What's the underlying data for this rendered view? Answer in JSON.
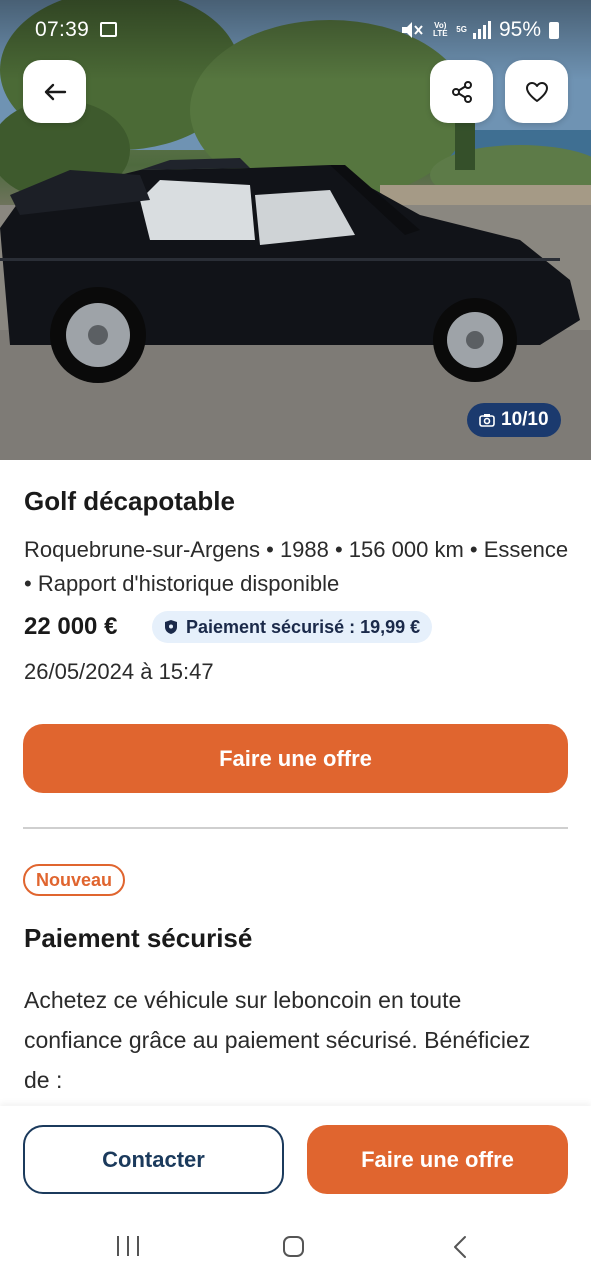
{
  "status_bar": {
    "time": "07:39",
    "battery": "95%",
    "icons": [
      "image-icon",
      "mute-icon",
      "volte-icon",
      "5g-icon",
      "signal-icon",
      "battery-icon"
    ],
    "volte_label": "Vo) LTE",
    "network_label": "5G"
  },
  "photo": {
    "counter": "10/10",
    "counter_icon": "camera-icon"
  },
  "header_buttons": {
    "back_icon": "arrow-left-icon",
    "share_icon": "share-icon",
    "favorite_icon": "heart-icon"
  },
  "listing": {
    "title": "Golf décapotable",
    "details": "Roquebrune-sur-Argens • 1988 • 156 000 km • Essence • Rapport d'historique disponible",
    "price": "22 000 €",
    "secure_payment_badge": "Paiement sécurisé : 19,99 €",
    "date": "26/05/2024 à 15:47",
    "offer_button": "Faire une offre"
  },
  "secure_section": {
    "badge": "Nouveau",
    "title": "Paiement sécurisé",
    "body": "Achetez ce véhicule sur leboncoin en toute confiance grâce au paiement sécurisé. Bénéficiez de :"
  },
  "action_bar": {
    "contact_label": "Contacter",
    "offer_label": "Faire une offre"
  },
  "colors": {
    "accent": "#e0652f",
    "navy": "#1b3a5c",
    "badge_bg": "#e6f0fb",
    "counter_bg": "#1b3a6e"
  }
}
